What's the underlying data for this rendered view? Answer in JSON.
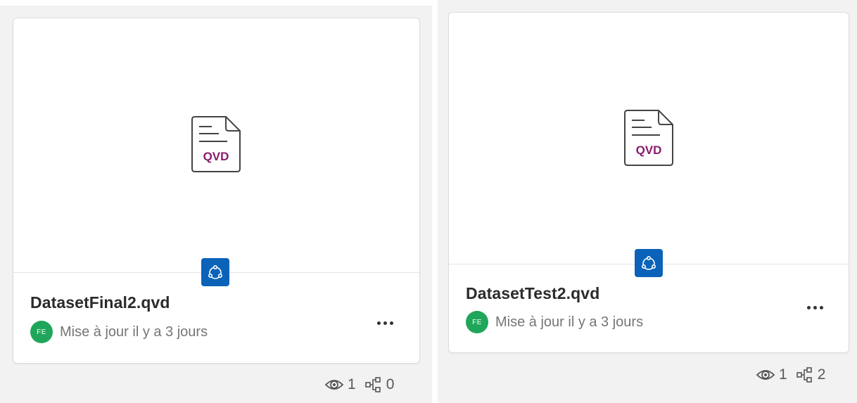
{
  "colors": {
    "panel_bg": "#f2f2f2",
    "card_bg": "#ffffff",
    "qvd_accent": "#8a1a6e",
    "type_badge": "#0a63b8",
    "avatar": "#1fa65a"
  },
  "cards": [
    {
      "title": "DatasetFinal2.qvd",
      "file_icon_text": "QVD",
      "type_badge_icon": "dataset-icon",
      "owner_initials": "FE",
      "updated_text": "Mise à jour il y a 3 jours",
      "more_icon": "more-options-icon",
      "views": "1",
      "lineage": "0"
    },
    {
      "title": "DatasetTest2.qvd",
      "file_icon_text": "QVD",
      "type_badge_icon": "dataset-icon",
      "owner_initials": "FE",
      "updated_text": "Mise à jour il y a 3 jours",
      "more_icon": "more-options-icon",
      "views": "1",
      "lineage": "2"
    }
  ]
}
